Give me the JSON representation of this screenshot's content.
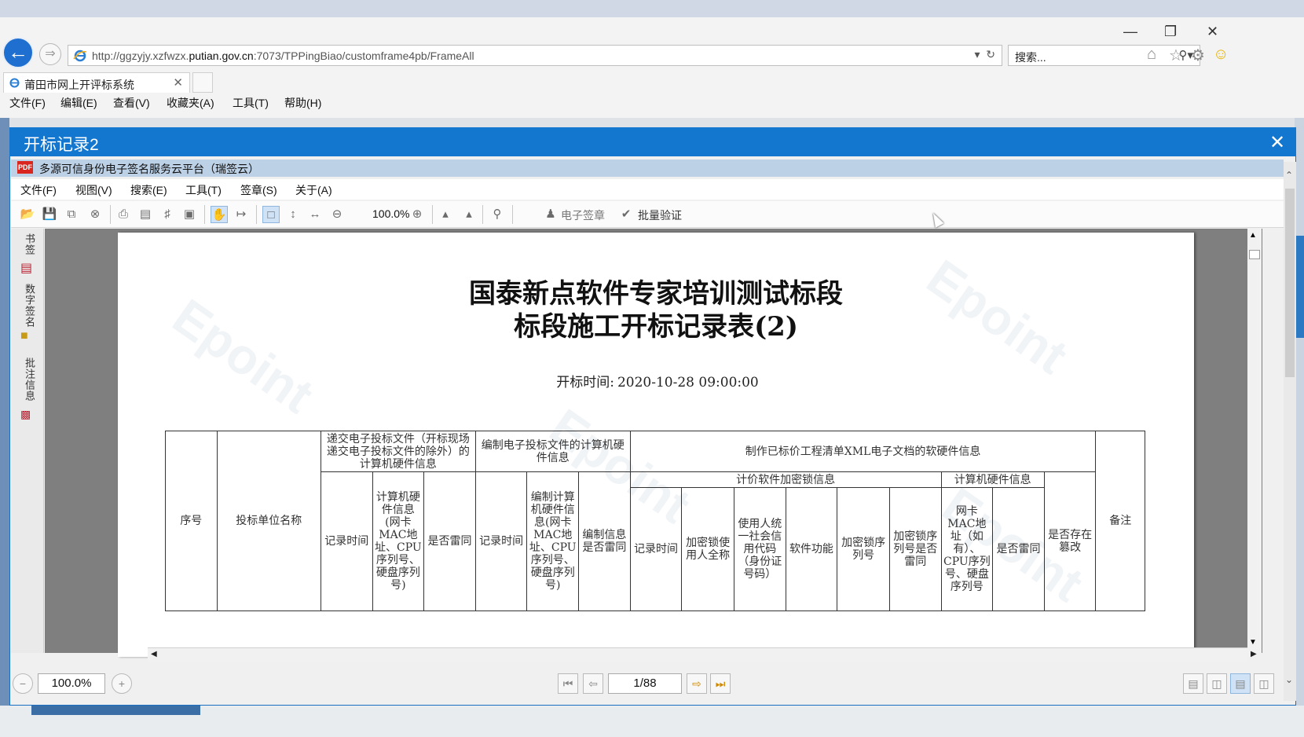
{
  "browser": {
    "url_prefix": "http://ggzyjy.xzfwzx.",
    "url_domain": "putian.gov.cn",
    "url_suffix": ":7073/TPPingBiao/customframe4pb/FrameAll",
    "search_placeholder": "搜索...",
    "tab_title": "莆田市网上开评标系统",
    "menu": [
      "文件(F)",
      "编辑(E)",
      "查看(V)",
      "收藏夹(A)",
      "工具(T)",
      "帮助(H)"
    ]
  },
  "dialog": {
    "title": "开标记录2",
    "plugin_title": "多源可信身份电子签名服务云平台（瑞签云）",
    "menu": [
      "文件(F)",
      "视图(V)",
      "搜索(E)",
      "工具(T)",
      "签章(S)",
      "关于(A)"
    ],
    "toolbar": {
      "zoom": "100.0%",
      "esign": "电子签章",
      "batch_verify": "批量验证"
    },
    "side_tabs": [
      "书签",
      "数字签名",
      "批注信息"
    ],
    "bottom": {
      "zoom": "100.0%",
      "page": "1/88"
    }
  },
  "document": {
    "title_line1": "国泰新点软件专家培训测试标段",
    "title_line2": "标段施工开标记录表(2)",
    "time_label": "开标时间:",
    "time_value": "2020-10-28 09:00:00",
    "table": {
      "h_seq": "序号",
      "h_unit": "投标单位名称",
      "h_submit_group": "递交电子投标文件（开标现场递交电子投标文件的除外）的计算机硬件信息",
      "h_compile_group": "编制电子投标文件的计算机硬件信息",
      "h_xml_group": "制作已标价工程清单XML电子文档的软硬件信息",
      "h_remark": "备注",
      "h_lock_group": "计价软件加密锁信息",
      "h_hw_group": "计算机硬件信息",
      "h_tamper": "是否存在篡改",
      "sub": {
        "record_time_1": "记录时间",
        "hw_info_1": "计算机硬件信息(网卡MAC地址、CPU序列号、硬盘序列号)",
        "same_1": "是否雷同",
        "record_time_2": "记录时间",
        "hw_info_2": "编制计算机硬件信息(网卡MAC地址、CPU序列号、硬盘序列号)",
        "same_2": "编制信息是否雷同",
        "record_time_3": "记录时间",
        "lock_user": "加密锁使用人全称",
        "credit_code": "使用人统一社会信用代码（身份证号码）",
        "sw_function": "软件功能",
        "lock_serial": "加密锁序列号",
        "lock_serial_same": "加密锁序列号是否雷同",
        "nic_info": "网卡MAC地址（如有）、CPU序列号、硬盘序列号",
        "same_3": "是否雷同"
      }
    }
  },
  "colors": {
    "dialog_title_bg": "#1376cf",
    "plugin_bar_bg": "#bdd1e6",
    "back_button": "#1e6fd0"
  }
}
